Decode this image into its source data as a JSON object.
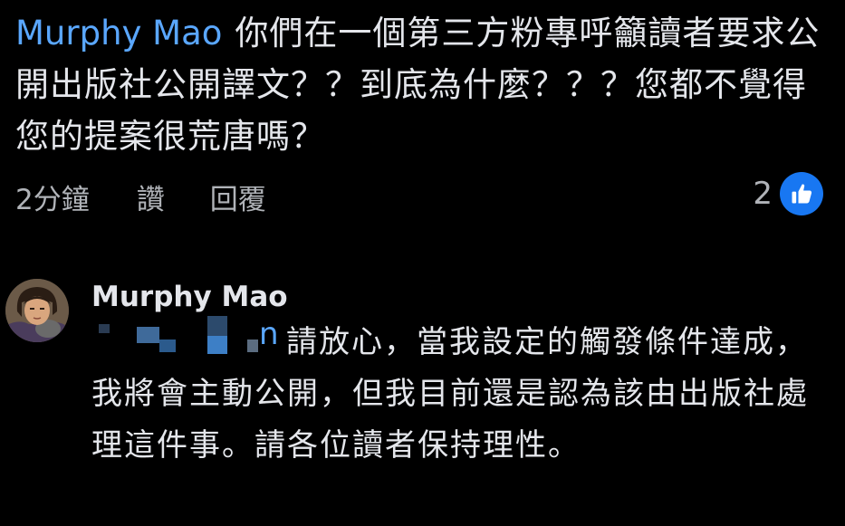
{
  "comment1": {
    "mention": "Murphy Mao",
    "text": "你們在一個第三方粉專呼籲讀者要求公開出版社公開譯文？？到底為什麼？？？您都不覺得您的提案很荒唐嗎？",
    "time": "2分鐘",
    "like_label": "讚",
    "reply_label": "回覆",
    "reaction_count": "2",
    "reaction_icon": "thumbs-up-icon"
  },
  "reply": {
    "author": "Murphy Mao",
    "mention_tail": "n",
    "text": "請放心，當我設定的觸發條件達成，我將會主動公開，但我目前還是認為該由出版社處理這件事。請各位讀者保持理性。"
  },
  "colors": {
    "background": "#000000",
    "text": "#e4e6eb",
    "secondary_text": "#b0b3b8",
    "mention": "#5aa7ff",
    "like_badge": "#1877f2"
  }
}
